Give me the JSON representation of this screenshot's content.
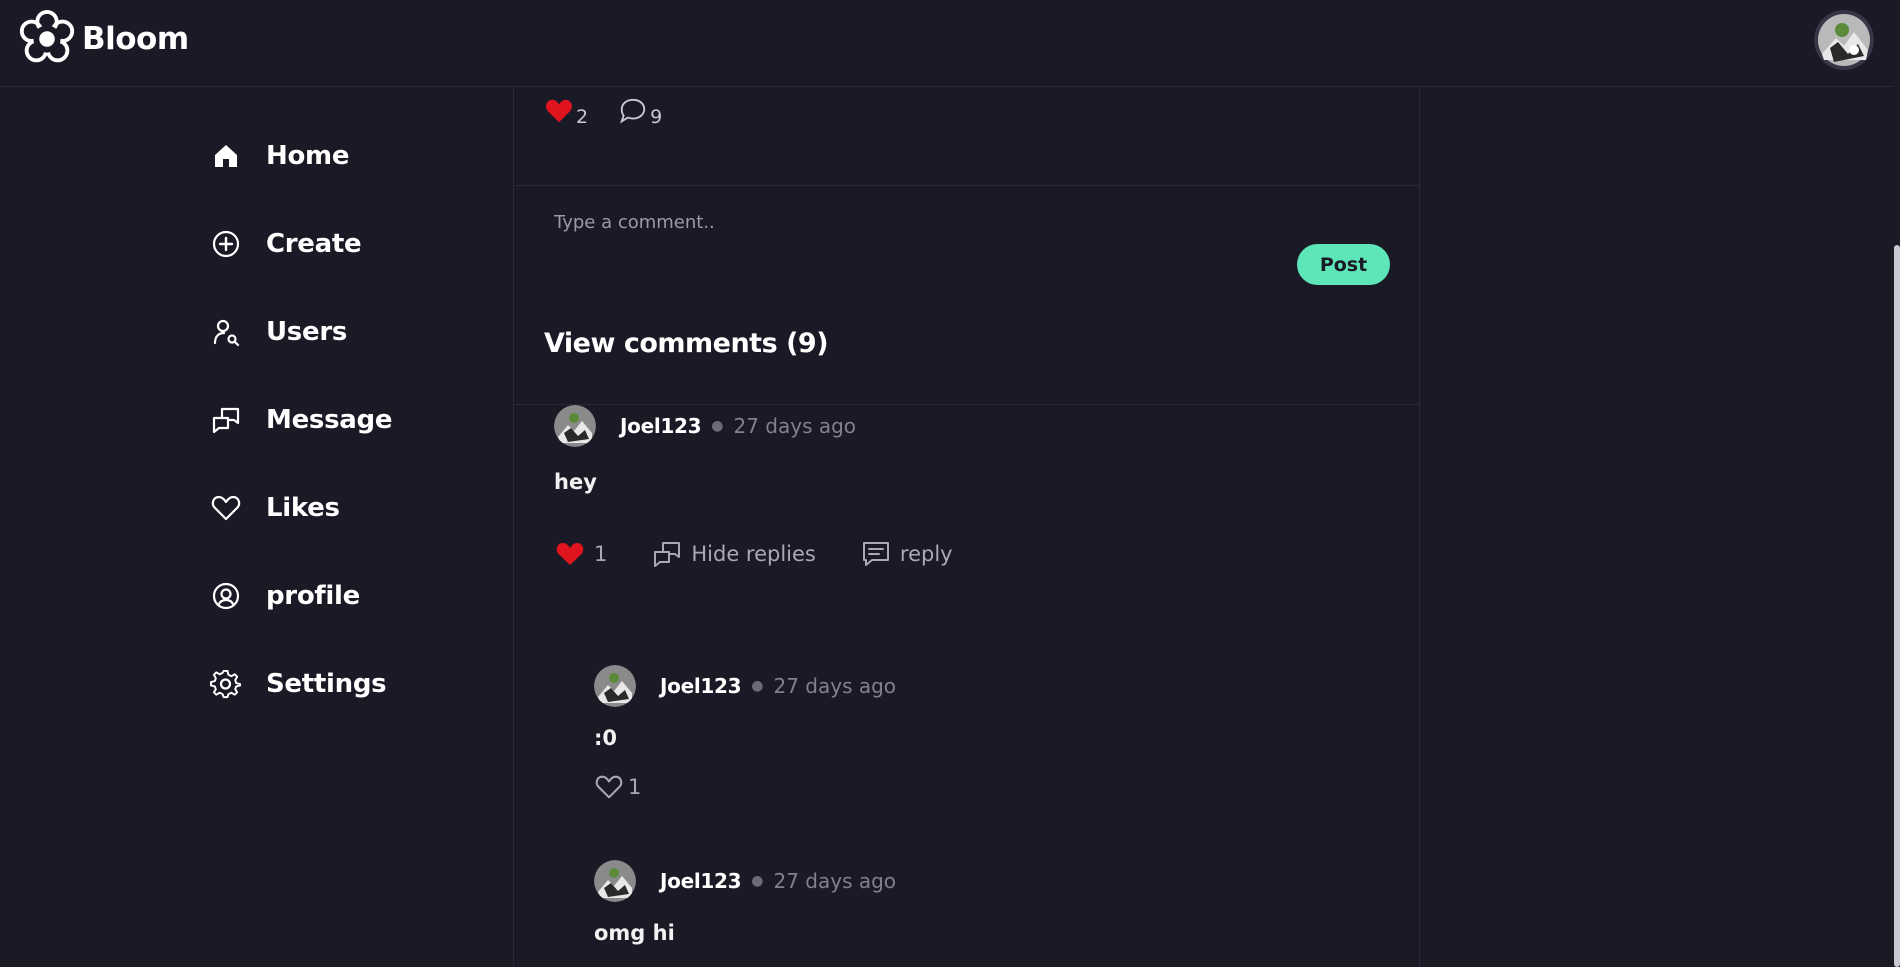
{
  "app": {
    "name": "Bloom"
  },
  "sidebar": {
    "items": [
      {
        "label": "Home",
        "icon": "home-icon"
      },
      {
        "label": "Create",
        "icon": "plus-circle-icon"
      },
      {
        "label": "Users",
        "icon": "user-search-icon"
      },
      {
        "label": "Message",
        "icon": "messages-icon"
      },
      {
        "label": "Likes",
        "icon": "heart-icon"
      },
      {
        "label": "profile",
        "icon": "user-circle-icon"
      },
      {
        "label": "Settings",
        "icon": "gear-icon"
      }
    ]
  },
  "post": {
    "likes": "2",
    "comments": "9"
  },
  "comment_form": {
    "placeholder": "Type a comment..",
    "post_label": "Post"
  },
  "comments_section": {
    "view_label": "View comments (9)",
    "comments": [
      {
        "user": "Joel123",
        "time": "27 days ago",
        "text": "hey",
        "likes": "1",
        "hide_replies_label": "Hide replies",
        "reply_label": "reply",
        "replies": [
          {
            "user": "Joel123",
            "time": "27 days ago",
            "text": ":0",
            "likes": "1"
          },
          {
            "user": "Joel123",
            "time": "27 days ago",
            "text": "omg hi"
          }
        ]
      }
    ]
  },
  "colors": {
    "background": "#1a1926",
    "accent": "#5ee6b8",
    "like_red": "#e0141e",
    "muted_text": "#80808e"
  }
}
